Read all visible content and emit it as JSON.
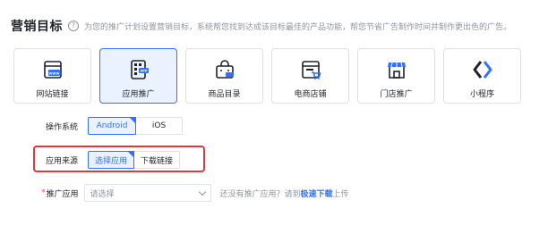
{
  "header": {
    "title": "营销目标",
    "help_icon": "help-circle-icon",
    "help_glyph": "?",
    "description": "为您的推广计划设置营销目标，系统帮您找到达成该目标最佳的产品功能，帮您节省广告制作时间并制作更出色的广告。"
  },
  "goals": [
    {
      "label": "网站链接",
      "icon": "website-icon",
      "badge": "WWW",
      "selected": false
    },
    {
      "label": "应用推广",
      "icon": "app-icon",
      "badge": "APP",
      "selected": true
    },
    {
      "label": "商品目录",
      "icon": "shopping-bag-icon",
      "selected": false
    },
    {
      "label": "电商店铺",
      "icon": "online-store-icon",
      "selected": false
    },
    {
      "label": "门店推广",
      "icon": "storefront-icon",
      "selected": false
    },
    {
      "label": "小程序",
      "icon": "mini-program-icon",
      "selected": false
    }
  ],
  "os": {
    "label": "操作系统",
    "options": [
      "Android",
      "iOS"
    ],
    "selected": "Android"
  },
  "app_source": {
    "label": "应用来源",
    "options": [
      "选择应用",
      "下载链接"
    ],
    "selected": "选择应用"
  },
  "promo_app": {
    "required_mark": "*",
    "label": "推广应用",
    "placeholder": "请选择",
    "hint_prefix": "还没有推广应用？请到",
    "hint_link": "极速下载",
    "hint_suffix": "上传"
  },
  "colors": {
    "accent": "#3370ff",
    "highlight": "#e5343a"
  }
}
